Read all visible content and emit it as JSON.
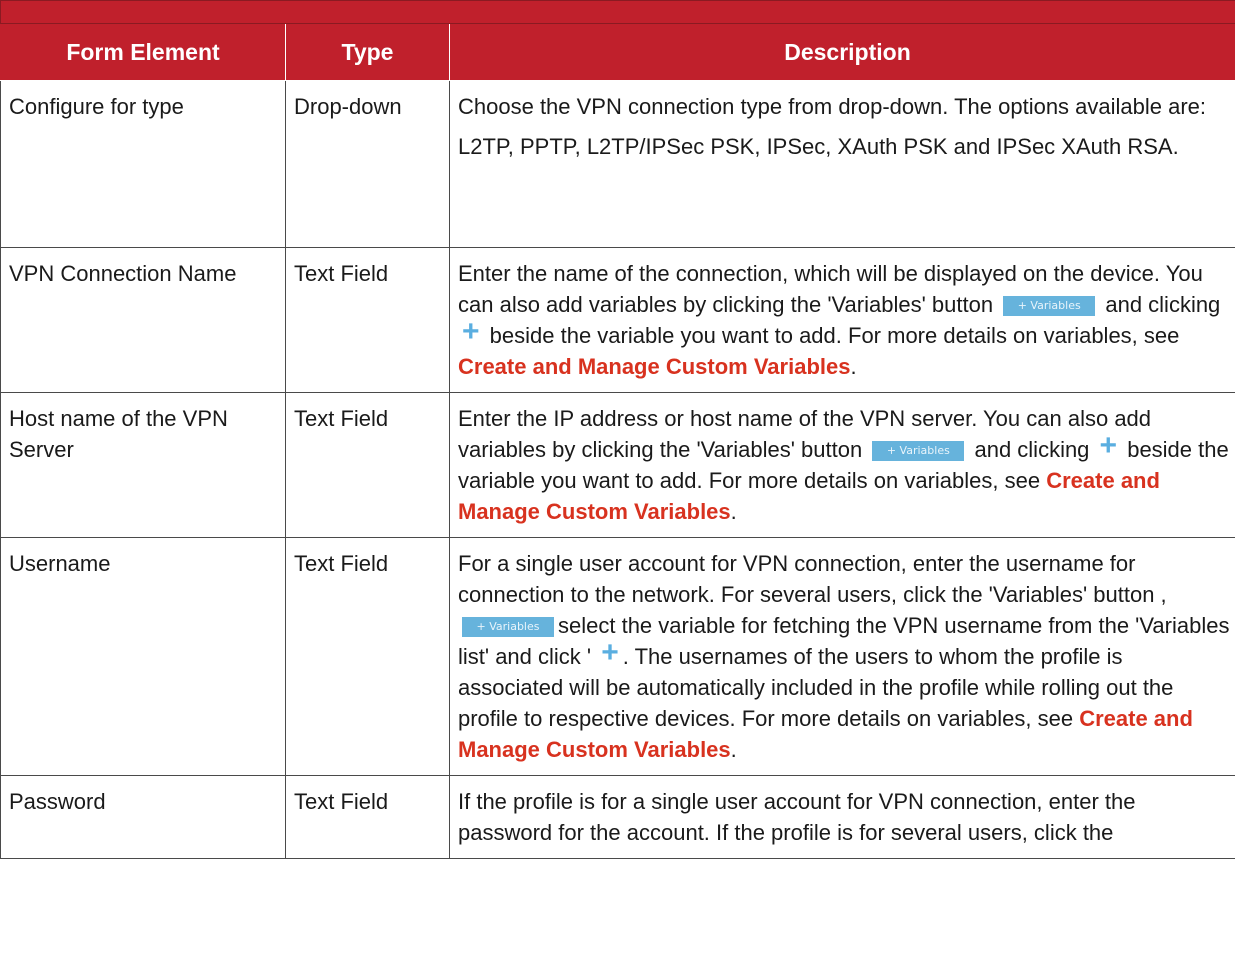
{
  "table": {
    "title": "",
    "headers": {
      "element": "Form Element",
      "type": "Type",
      "description": "Description"
    },
    "rows": [
      {
        "element": "Configure for type",
        "type": "Drop-down",
        "desc_p1": "Choose the VPN connection type from drop-down. The options available are:",
        "desc_p2": "L2TP, PPTP, L2TP/IPSec PSK, IPSec, XAuth PSK and IPSec XAuth RSA."
      },
      {
        "element": "VPN Connection Name",
        "type": "Text Field",
        "desc_a": "Enter the name of the connection, which will be displayed on the device. You can also add variables by clicking the 'Variables' button",
        "desc_b": "and clicking",
        "desc_c": "beside the variable you want to add. For more details on variables, see",
        "link": "Create and Manage Custom Variables",
        "desc_end": "."
      },
      {
        "element": "Host name of the VPN Server",
        "type": "Text Field",
        "desc_a": "Enter the IP address or host name of the VPN server. You can also add variables by clicking the 'Variables' button",
        "desc_b": "and clicking",
        "desc_c": "beside the variable you want to add. For more details on variables, see",
        "link": "Create and Manage Custom Variables",
        "desc_end": "."
      },
      {
        "element": "Username",
        "type": "Text Field",
        "desc_a": "For a single user account for VPN connection, enter the username for connection to the network. For several users, click the 'Variables' button ,",
        "desc_b": "select the variable for fetching the VPN username from the 'Variables list' and click '",
        "desc_c": ". The usernames of the users to whom the profile is associated will be automatically included in the profile while rolling out the profile to respective devices. For more details on variables, see",
        "link": "Create and Manage Custom Variables",
        "desc_end": "."
      },
      {
        "element": "Password",
        "type": "Text Field",
        "desc_a": "If the profile is for a single user account for VPN connection, enter the password for the account. If the profile is for several users, click the"
      }
    ]
  },
  "variables_button": {
    "label": "+ Variables",
    "color": "#66b3dc"
  },
  "icons": {
    "plus": "plus-icon"
  },
  "colors": {
    "header_bg": "#c0202c",
    "link": "#d8321f"
  }
}
